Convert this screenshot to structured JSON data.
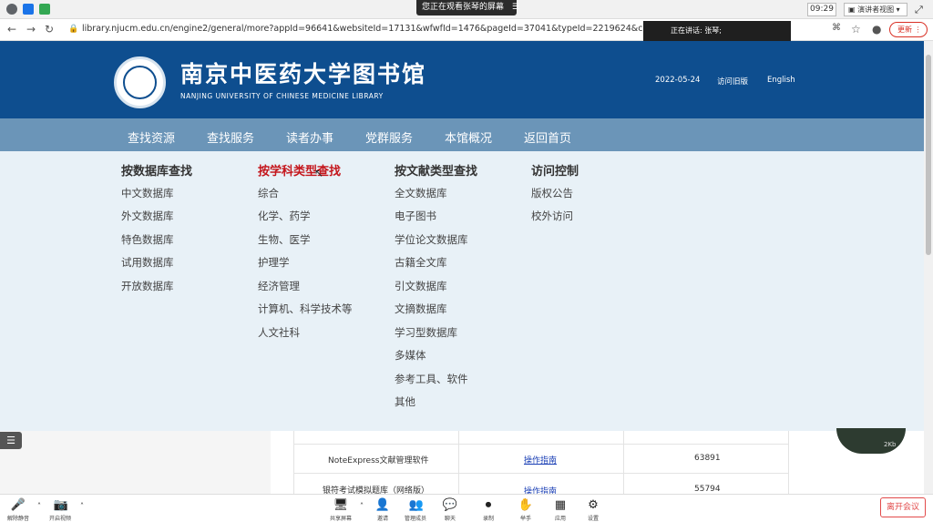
{
  "meeting": {
    "share_banner": "您正在观看张琴的屏幕",
    "banner_icon": "☰",
    "clock": "09:29",
    "presenter_view": "演讲者视图",
    "speaking": "正在讲话: 张琴;",
    "leave": "离开会议",
    "toolbar": [
      {
        "icon": "🎤",
        "label": "解除静音"
      },
      {
        "icon": "📷",
        "label": "开启视频"
      },
      {
        "icon": "🖥",
        "label": "共享屏幕"
      },
      {
        "icon": "👤",
        "label": "邀请"
      },
      {
        "icon": "👥",
        "label": "管理成员"
      },
      {
        "icon": "💬",
        "label": "聊天"
      },
      {
        "icon": "⏺",
        "label": "录制"
      },
      {
        "icon": "✋",
        "label": "举手"
      },
      {
        "icon": "▦",
        "label": "应用"
      },
      {
        "icon": "⚙",
        "label": "设置"
      }
    ]
  },
  "browser": {
    "url": "library.njucm.edu.cn/engine2/general/more?appId=96641&websiteId=17131&wfwfId=1476&pageId=37041&typeId=2219624&currentBranch=",
    "update": "更新"
  },
  "header": {
    "name_cn": "南京中医药大学图书馆",
    "name_en": "NANJING UNIVERSITY OF CHINESE MEDICINE   LIBRARY",
    "date": "2022-05-24",
    "old_site": "访问旧版",
    "english": "English"
  },
  "menu": [
    "查找资源",
    "查找服务",
    "读者办事",
    "党群服务",
    "本馆概况",
    "返回首页"
  ],
  "dropdown": [
    {
      "title": "按数据库查找",
      "active": false,
      "items": [
        "中文数据库",
        "外文数据库",
        "特色数据库",
        "试用数据库",
        "开放数据库"
      ]
    },
    {
      "title": "按学科类型查找",
      "active": true,
      "items": [
        "综合",
        "化学、药学",
        "生物、医学",
        "护理学",
        "经济管理",
        "计算机、科学技术等",
        "人文社科"
      ]
    },
    {
      "title": "按文献类型查找",
      "active": false,
      "items": [
        "全文数据库",
        "电子图书",
        "学位论文数据库",
        "古籍全文库",
        "引文数据库",
        "文摘数据库",
        "学习型数据库",
        "多媒体",
        "参考工具、软件",
        "其他"
      ]
    },
    {
      "title": "访问控制",
      "active": false,
      "items": [
        "版权公告",
        "校外访问"
      ]
    }
  ],
  "table_rows": [
    {
      "name": "NoteExpress文献管理软件",
      "guide": "操作指南",
      "count": "63891"
    },
    {
      "name": "银符考试模拟题库（网络版）",
      "guide": "操作指南",
      "count": "55794"
    }
  ],
  "widget_value": "2Kb"
}
